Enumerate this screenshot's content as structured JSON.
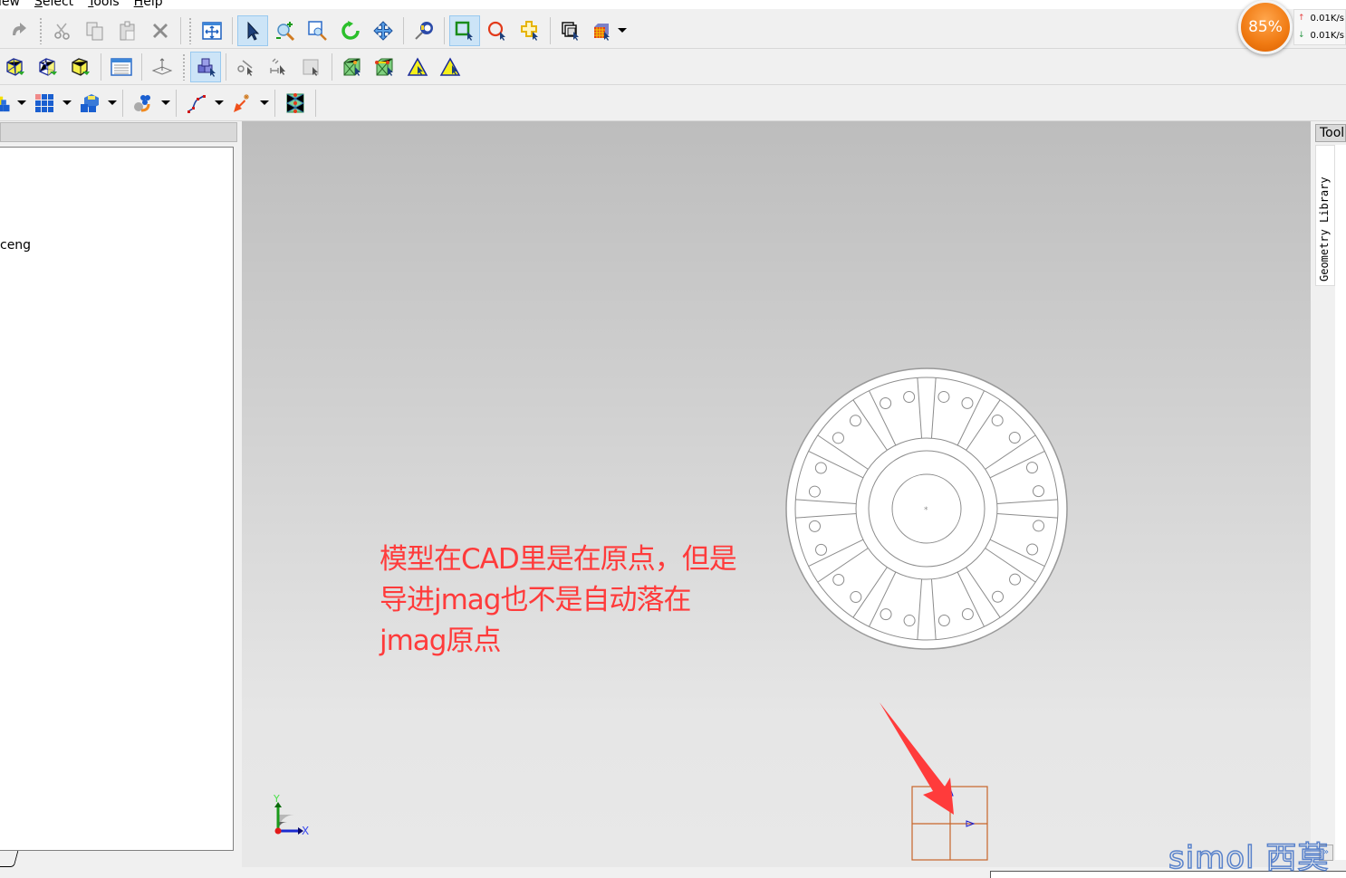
{
  "menubar": {
    "items": [
      {
        "label_pre": "",
        "label_u": "",
        "label_post": "iew",
        "name": "view"
      },
      {
        "label_pre": "",
        "label_u": "S",
        "label_post": "elect",
        "name": "select"
      },
      {
        "label_pre": "",
        "label_u": "T",
        "label_post": "ools",
        "name": "tools"
      },
      {
        "label_pre": "",
        "label_u": "H",
        "label_post": "elp",
        "name": "help"
      }
    ]
  },
  "toolbar1": {
    "icons": [
      "redo-icon",
      "cut-icon",
      "copy-icon",
      "paste-icon",
      "delete-icon",
      "fit-view-icon",
      "select-pointer-icon",
      "zoom-in-out-icon",
      "zoom-box-icon",
      "rotate-icon",
      "pan-icon",
      "measure-tape-icon",
      "select-rectangle-icon",
      "select-circle-icon",
      "select-polygon-icon",
      "select-layers-icon",
      "select-mesh-icon"
    ]
  },
  "toolbar2": {
    "icons": [
      "view-iso-1-icon",
      "view-iso-2-icon",
      "view-iso-3-icon",
      "properties-panel-icon",
      "plane-axis-icon",
      "select-parts-icon",
      "select-arc-icon",
      "select-dimension-icon",
      "select-face-icon",
      "select-vertex-icon",
      "select-edge-icon",
      "select-triangle-1-icon",
      "select-triangle-2-icon"
    ]
  },
  "toolbar3": {
    "icons": [
      "create-part-icon",
      "array-parts-icon",
      "assembly-icon",
      "transform-parts-icon",
      "polyline-icon",
      "point-icon",
      "mesh-nodes-icon"
    ]
  },
  "network": {
    "percent": "85%",
    "upload": "0.01K/s",
    "download": "0.01K/s"
  },
  "left_panel": {
    "tree_item": "ceng"
  },
  "right_panel": {
    "header": "Toolbox",
    "tab": "Geometry Library"
  },
  "viewport": {
    "annotation_line1": "模型在CAD里是在原点，但是",
    "annotation_line2": "导进jmag也不是自动落在",
    "annotation_line3": "jmag原点",
    "axis_x": "X",
    "axis_y": "Y",
    "colors": {
      "annotation": "#ff3b3b",
      "origin_box": "#c8652a",
      "geometry": "#8c8c8c"
    }
  },
  "watermark": "simol 西莫",
  "expand_button": "»"
}
